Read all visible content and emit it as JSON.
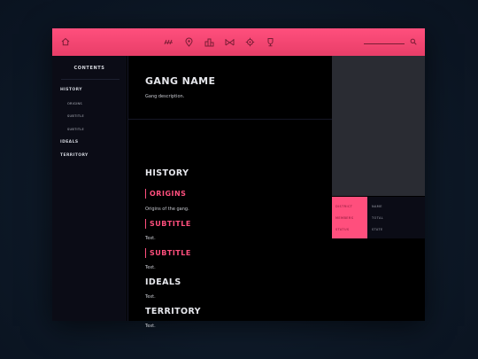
{
  "topbar": {
    "home_icon": "home-icon",
    "nav_icons": [
      "district-icon",
      "location-pin-icon",
      "buildings-icon",
      "bridge-icon",
      "gear-icon",
      "trophy-icon"
    ],
    "search_placeholder": "",
    "search_icon": "search-icon",
    "accent": "#ff4f7d"
  },
  "sidebar": {
    "title": "CONTENTS",
    "items": [
      {
        "label": "HISTORY"
      },
      {
        "label": "ORIGINS"
      },
      {
        "label": "SUBTITLE"
      },
      {
        "label": "SUBTITLE"
      },
      {
        "label": "IDEALS"
      },
      {
        "label": "TERRITORY"
      }
    ]
  },
  "main": {
    "gang_name": "GANG NAME",
    "gang_description": "Gang description.",
    "history_heading": "HISTORY",
    "origins_heading": "ORIGINS",
    "origins_text": "Origins of the gang.",
    "subtitle1_heading": "SUBTITLE",
    "subtitle1_text": "Text.",
    "subtitle2_heading": "SUBTITLE",
    "subtitle2_text": "Text.",
    "ideals_heading": "IDEALS",
    "ideals_text": "Text.",
    "territory_heading": "TERRITORY",
    "territory_text": "Text."
  },
  "infobox": {
    "rows": [
      {
        "label": "DISTRICT",
        "value": "NAME"
      },
      {
        "label": "MEMBERS",
        "value": "TOTAL"
      },
      {
        "label": "STATUS",
        "value": "STATE"
      }
    ]
  }
}
